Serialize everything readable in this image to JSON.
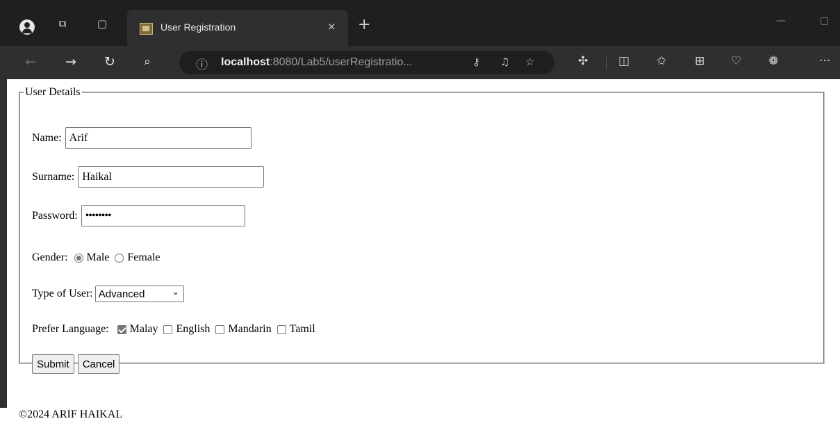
{
  "browser": {
    "tab_title": "User Registration",
    "url_host": "localhost",
    "url_rest": ":8080/Lab5/userRegistratio...",
    "tab_close": "×",
    "new_tab": "+",
    "more": "···"
  },
  "form": {
    "legend": "User Details",
    "name_label": "Name:",
    "name_value": "Arif",
    "surname_label": "Surname:",
    "surname_value": "Haikal",
    "password_label": "Password:",
    "password_value": "••••••••",
    "gender_label": "Gender:",
    "gender_options": [
      "Male",
      "Female"
    ],
    "gender_selected": "Male",
    "usertype_label": "Type of User:",
    "usertype_value": "Advanced",
    "language_label": "Prefer Language:",
    "language_options": [
      "Malay",
      "English",
      "Mandarin",
      "Tamil"
    ],
    "language_checked": [
      "Malay"
    ],
    "submit_label": "Submit",
    "cancel_label": "Cancel"
  },
  "footer": {
    "text": "©2024 ARIF HAIKAL"
  }
}
